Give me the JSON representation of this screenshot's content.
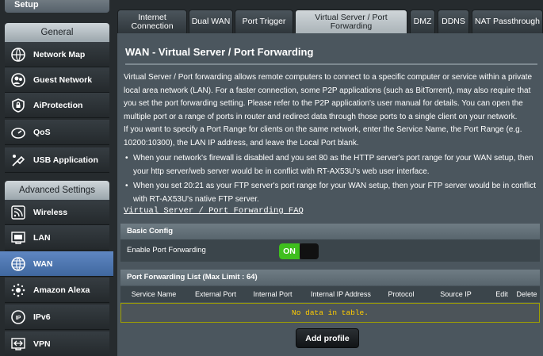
{
  "sidebar": {
    "setup_label": "Setup",
    "general_header": "General",
    "general_items": [
      {
        "label": "Network Map",
        "icon": "network-map-icon"
      },
      {
        "label": "Guest Network",
        "icon": "guest-network-icon"
      },
      {
        "label": "AiProtection",
        "icon": "shield-lock-icon"
      },
      {
        "label": "QoS",
        "icon": "speedometer-icon"
      },
      {
        "label": "USB Application",
        "icon": "usb-app-icon"
      }
    ],
    "advanced_header": "Advanced Settings",
    "advanced_items": [
      {
        "label": "Wireless",
        "icon": "wifi-icon"
      },
      {
        "label": "LAN",
        "icon": "lan-icon"
      },
      {
        "label": "WAN",
        "icon": "globe-icon",
        "active": true
      },
      {
        "label": "Amazon Alexa",
        "icon": "alexa-icon"
      },
      {
        "label": "IPv6",
        "icon": "ipv6-icon"
      },
      {
        "label": "VPN",
        "icon": "vpn-icon"
      }
    ]
  },
  "tabs": [
    {
      "label": "Internet Connection"
    },
    {
      "label": "Dual WAN"
    },
    {
      "label": "Port Trigger"
    },
    {
      "label": "Virtual Server / Port Forwarding",
      "active": true
    },
    {
      "label": "DMZ"
    },
    {
      "label": "DDNS"
    },
    {
      "label": "NAT Passthrough"
    }
  ],
  "main": {
    "title": "WAN - Virtual Server / Port Forwarding",
    "description": "Virtual Server / Port forwarding allows remote computers to connect to a specific computer or service within a private local area network (LAN). For a faster connection, some P2P applications (such as BitTorrent), may also require that you set the port forwarding setting. Please refer to the P2P application's user manual for details. You can open the multiple port or a range of ports in router and redirect data through those ports to a single client on your network.",
    "description2": "If you want to specify a Port Range for clients on the same network, enter the Service Name, the Port Range (e.g. 10200:10300), the LAN IP address, and leave the Local Port blank.",
    "bullet1": "When your network's firewall is disabled and you set 80 as the HTTP server's port range for your WAN setup, then your http server/web server would be in conflict with RT-AX53U's web user interface.",
    "bullet2": "When you set 20:21 as your FTP server's port range for your WAN setup, then your FTP server would be in conflict with RT-AX53U's native FTP server.",
    "faq_link": "Virtual Server / Port Forwarding FAQ",
    "basic_config_header": "Basic Config",
    "enable_label": "Enable Port Forwarding",
    "toggle_label": "ON",
    "list_header": "Port Forwarding List (Max Limit : 64)",
    "columns": [
      "Service Name",
      "External Port",
      "Internal Port",
      "Internal IP Address",
      "Protocol",
      "Source IP",
      "Edit",
      "Delete"
    ],
    "no_data": "No data in table.",
    "add_button": "Add profile"
  },
  "colors": {
    "active_nav": "#5a82bd",
    "toggle_on": "#3fbf1e",
    "no_data_text": "#ffcc00"
  }
}
